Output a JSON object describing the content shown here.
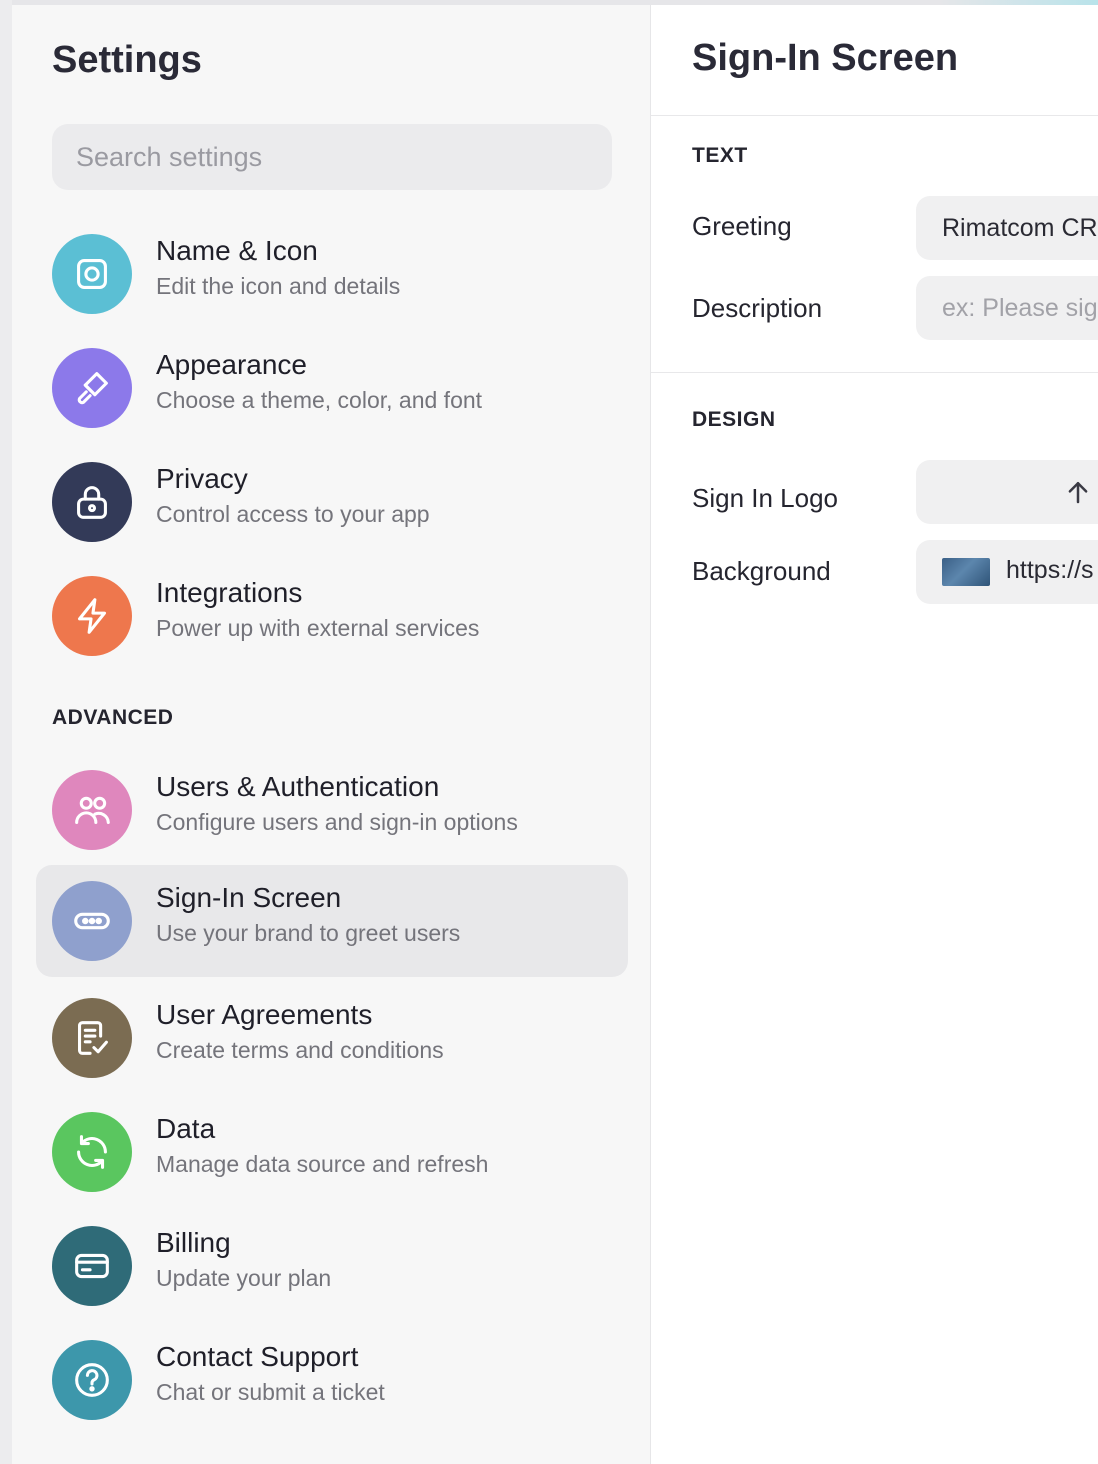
{
  "sidebar": {
    "title": "Settings",
    "search_placeholder": "Search settings",
    "items": [
      {
        "title": "Name & Icon",
        "subtitle": "Edit the icon and details",
        "icon": "camera-square-icon",
        "color": "#5bbfd4"
      },
      {
        "title": "Appearance",
        "subtitle": "Choose a theme, color, and font",
        "icon": "paintbrush-icon",
        "color": "#8c79ea"
      },
      {
        "title": "Privacy",
        "subtitle": "Control access to your app",
        "icon": "lock-icon",
        "color": "#333a58"
      },
      {
        "title": "Integrations",
        "subtitle": "Power up with external services",
        "icon": "lightning-icon",
        "color": "#ee774d"
      }
    ],
    "advanced_label": "ADVANCED",
    "advanced_items": [
      {
        "title": "Users & Authentication",
        "subtitle": "Configure users and sign-in options",
        "icon": "users-icon",
        "color": "#df87bd"
      },
      {
        "title": "Sign-In Screen",
        "subtitle": "Use your brand to greet users",
        "icon": "password-field-icon",
        "color": "#8fa0cd",
        "selected": true
      },
      {
        "title": "User Agreements",
        "subtitle": "Create terms and conditions",
        "icon": "document-check-icon",
        "color": "#7b6c52"
      },
      {
        "title": "Data",
        "subtitle": "Manage data source and refresh",
        "icon": "refresh-icon",
        "color": "#5ac65f"
      },
      {
        "title": "Billing",
        "subtitle": "Update your plan",
        "icon": "credit-card-icon",
        "color": "#2f6b78"
      },
      {
        "title": "Contact Support",
        "subtitle": "Chat or submit a ticket",
        "icon": "help-circle-icon",
        "color": "#3d97ab"
      }
    ]
  },
  "panel": {
    "title": "Sign-In Screen",
    "text_section": "TEXT",
    "greeting_label": "Greeting",
    "greeting_value": "Rimatcom CR",
    "description_label": "Description",
    "description_placeholder": "ex: Please sign in",
    "design_section": "DESIGN",
    "logo_label": "Sign In Logo",
    "upload_icon": "arrow-up-icon",
    "background_label": "Background",
    "background_url": "https://s"
  }
}
